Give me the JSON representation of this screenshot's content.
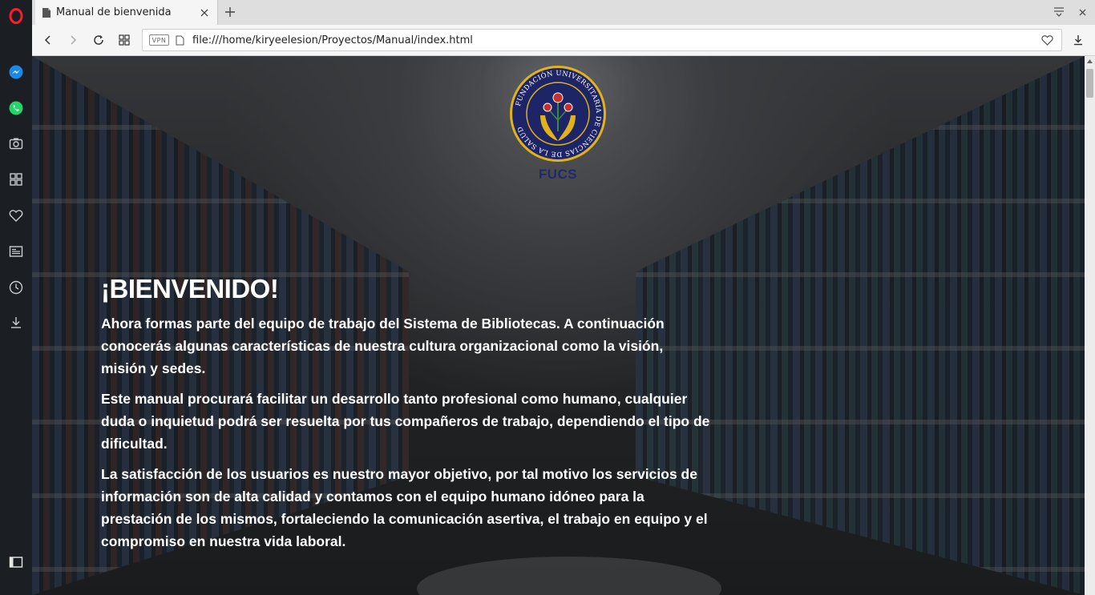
{
  "browser": {
    "tab": {
      "title": "Manual de bienvenida"
    },
    "address": {
      "vpn_label": "VPN",
      "url": "file:///home/kiryeelesion/Proyectos/Manual/index.html"
    }
  },
  "sidebar": {
    "items": [
      {
        "name": "opera",
        "icon": "opera-logo-icon"
      },
      {
        "name": "messenger",
        "icon": "messenger-icon"
      },
      {
        "name": "whatsapp",
        "icon": "whatsapp-icon"
      },
      {
        "name": "snapshot",
        "icon": "camera-icon"
      },
      {
        "name": "speed-dial",
        "icon": "grid-icon"
      },
      {
        "name": "bookmarks",
        "icon": "heart-icon"
      },
      {
        "name": "news",
        "icon": "news-icon"
      },
      {
        "name": "history",
        "icon": "clock-icon"
      },
      {
        "name": "downloads",
        "icon": "download-icon"
      },
      {
        "name": "toggle-sidebar",
        "icon": "sidebar-toggle-icon"
      }
    ]
  },
  "page": {
    "logo": {
      "ring_text": "FUNDACIÓN UNIVERSITARIA DE CIENCIAS DE LA SALUD",
      "acronym": "FUCS",
      "colors": {
        "ring": "#e2b21c",
        "fill": "#1e2567",
        "accent": "#c9302c",
        "leaf": "#3b8a3a"
      }
    },
    "headline": "¡BIENVENIDO!",
    "paragraphs": [
      "Ahora formas parte del equipo de trabajo del Sistema de Bibliotecas. A continuación conocerás algunas características de nuestra cultura organizacional como la visión, misión y sedes.",
      "Este manual procurará facilitar un desarrollo tanto profesional como humano, cualquier duda o inquietud podrá ser resuelta por tus compañeros de trabajo, dependiendo el tipo de dificultad.",
      "La satisfacción de los usuarios es nuestro mayor objetivo, por tal motivo los servicios de información son de alta calidad y contamos con el equipo humano idóneo para la prestación de los mismos, fortaleciendo la comunicación asertiva, el trabajo en equipo y el compromiso en nuestra vida laboral."
    ]
  }
}
